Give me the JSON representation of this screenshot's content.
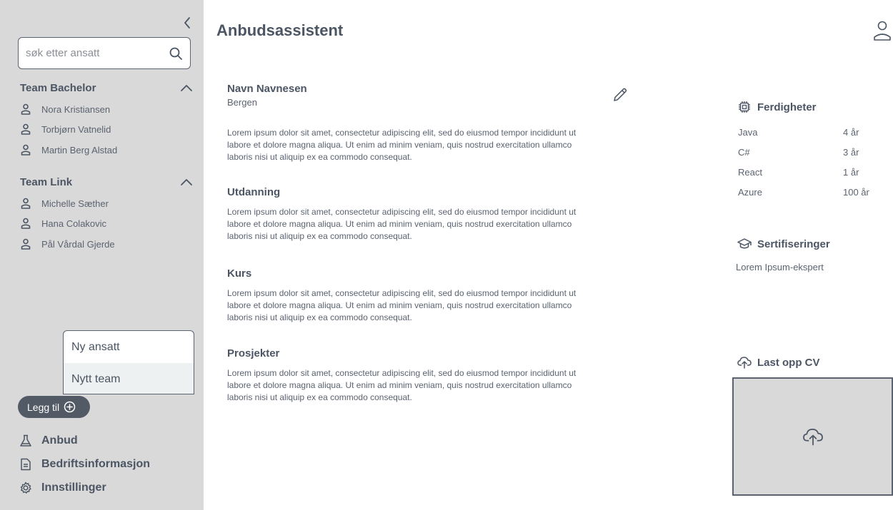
{
  "sidebar": {
    "search_placeholder": "søk etter ansatt",
    "teams": [
      {
        "name": "Team Bachelor",
        "members": [
          "Nora Kristiansen",
          "Torbjørn Vatnelid",
          "Martin Berg Alstad"
        ]
      },
      {
        "name": "Team Link",
        "members": [
          "Michelle Sæther",
          "Hana Colakovic",
          "Pål Vårdal Gjerde"
        ]
      }
    ],
    "dropdown": {
      "items": [
        "Ny ansatt",
        "Nytt team"
      ]
    },
    "add_button_label": "Legg til",
    "nav": {
      "anbud": "Anbud",
      "bedriftsinformasjon": "Bedriftsinformasjon",
      "innstillinger": "Innstillinger"
    }
  },
  "header": {
    "title": "Anbudsassistent"
  },
  "profile": {
    "name": "Navn Navnesen",
    "location": "Bergen",
    "summary": "Lorem ipsum dolor sit amet, consectetur adipiscing elit, sed do eiusmod tempor incididunt ut labore et dolore magna aliqua. Ut enim ad minim veniam, quis nostrud exercitation ullamco laboris nisi ut aliquip ex ea commodo consequat.",
    "sections": [
      {
        "title": "Utdanning",
        "text": "Lorem ipsum dolor sit amet, consectetur adipiscing elit, sed do eiusmod tempor incididunt ut labore et dolore magna aliqua. Ut enim ad minim veniam, quis nostrud exercitation ullamco laboris nisi ut aliquip ex ea commodo consequat."
      },
      {
        "title": "Kurs",
        "text": "Lorem ipsum dolor sit amet, consectetur adipiscing elit, sed do eiusmod tempor incididunt ut labore et dolore magna aliqua. Ut enim ad minim veniam, quis nostrud exercitation ullamco laboris nisi ut aliquip ex ea commodo consequat."
      },
      {
        "title": "Prosjekter",
        "text": "Lorem ipsum dolor sit amet, consectetur adipiscing elit, sed do eiusmod tempor incididunt ut labore et dolore magna aliqua. Ut enim ad minim veniam, quis nostrud exercitation ullamco laboris nisi ut aliquip ex ea commodo consequat."
      }
    ]
  },
  "skills": {
    "title": "Ferdigheter",
    "items": [
      {
        "name": "Java",
        "years": "4 år"
      },
      {
        "name": "C#",
        "years": "3 år"
      },
      {
        "name": "React",
        "years": "1 år"
      },
      {
        "name": "Azure",
        "years": "100 år"
      }
    ]
  },
  "certifications": {
    "title": "Sertifiseringer",
    "items": [
      "Lorem Ipsum-ekspert"
    ]
  },
  "upload": {
    "title": "Last opp CV"
  },
  "colors": {
    "sidebar_bg": "#d9d9d9",
    "text_dark": "#4b5563",
    "button_bg": "#525a66"
  }
}
